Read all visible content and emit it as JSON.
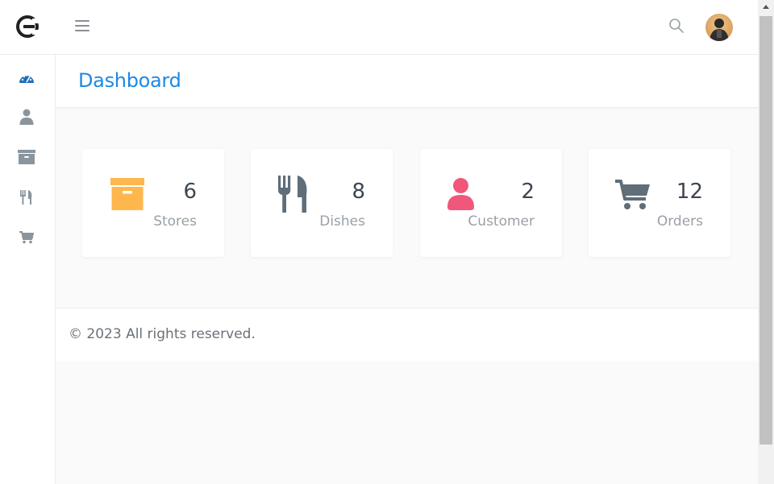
{
  "header": {
    "logo_icon": "brand-e-logo",
    "menu_icon": "hamburger-icon",
    "search_icon": "search-icon",
    "avatar_icon": "user-avatar"
  },
  "sidebar": {
    "items": [
      {
        "icon": "dashboard-gauge-icon",
        "color": "#1e6fb8"
      },
      {
        "icon": "user-icon",
        "color": "#8a959e"
      },
      {
        "icon": "archive-box-icon",
        "color": "#8a959e"
      },
      {
        "icon": "utensils-icon",
        "color": "#8a959e"
      },
      {
        "icon": "cart-icon",
        "color": "#8a959e"
      }
    ]
  },
  "page": {
    "title": "Dashboard"
  },
  "cards": [
    {
      "value": "6",
      "label": "Stores",
      "icon": "archive-box-icon",
      "color": "#ffb74d"
    },
    {
      "value": "8",
      "label": "Dishes",
      "icon": "utensils-icon",
      "color": "#5f6e78"
    },
    {
      "value": "2",
      "label": "Customer",
      "icon": "user-icon",
      "color": "#f0577a"
    },
    {
      "value": "12",
      "label": "Orders",
      "icon": "cart-icon",
      "color": "#5f6e78"
    }
  ],
  "footer": {
    "text": "© 2023 All rights reserved."
  }
}
